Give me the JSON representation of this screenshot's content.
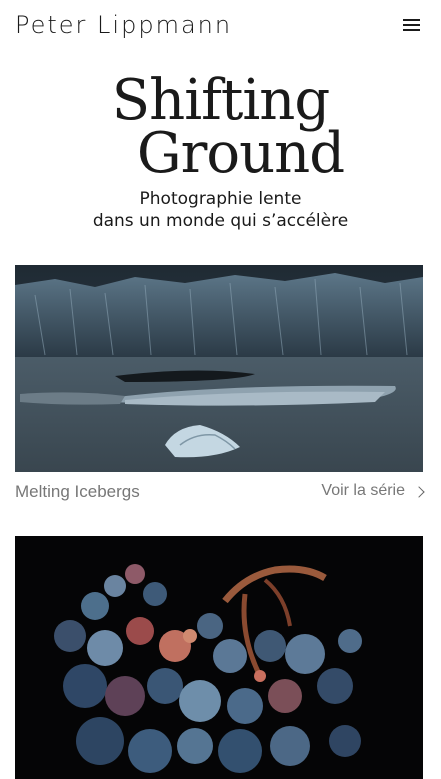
{
  "header": {
    "site_name": "Peter Lippmann",
    "menu_icon": "hamburger-menu-icon"
  },
  "hero": {
    "title_line1": "Shifting",
    "title_line2": "Ground",
    "subtitle_line1": "Photographie lente",
    "subtitle_line2": "dans un monde qui s’accélère"
  },
  "series": [
    {
      "title": "Melting Icebergs",
      "link_label": "Voir la série",
      "link_icon": "chevron-right-icon"
    },
    {
      "title": "",
      "link_label": ""
    }
  ],
  "colors": {
    "text": "#1a1a1a",
    "muted": "#777777",
    "background": "#ffffff"
  }
}
